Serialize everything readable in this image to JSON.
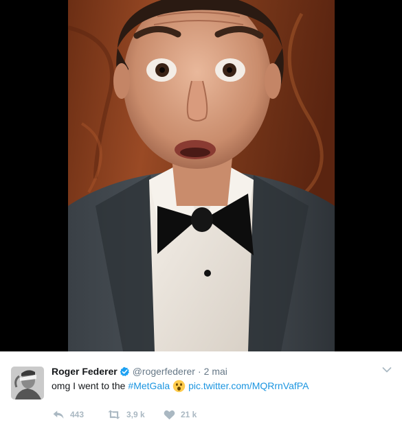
{
  "media": {
    "photo_icon": "selfie-photo",
    "colors": {
      "background": "#000000"
    }
  },
  "tweet": {
    "author": {
      "full_name": "Roger Federer",
      "screen_name": "@rogerfederer",
      "verified_icon": "verified-badge-icon"
    },
    "separator": "·",
    "timestamp": "2 mai",
    "text": {
      "prefix": "omg I went to the",
      "hashtag": "#MetGala",
      "emoji": "astonished-face-emoji",
      "link": "pic.twitter.com/MQRrnVafPA"
    },
    "actions": {
      "replies": "443",
      "retweets": "3,9 k",
      "likes": "21 k"
    },
    "colors": {
      "name": "#14171a",
      "meta": "#657786",
      "link": "#1b95e0",
      "action": "#aab8c2"
    }
  }
}
